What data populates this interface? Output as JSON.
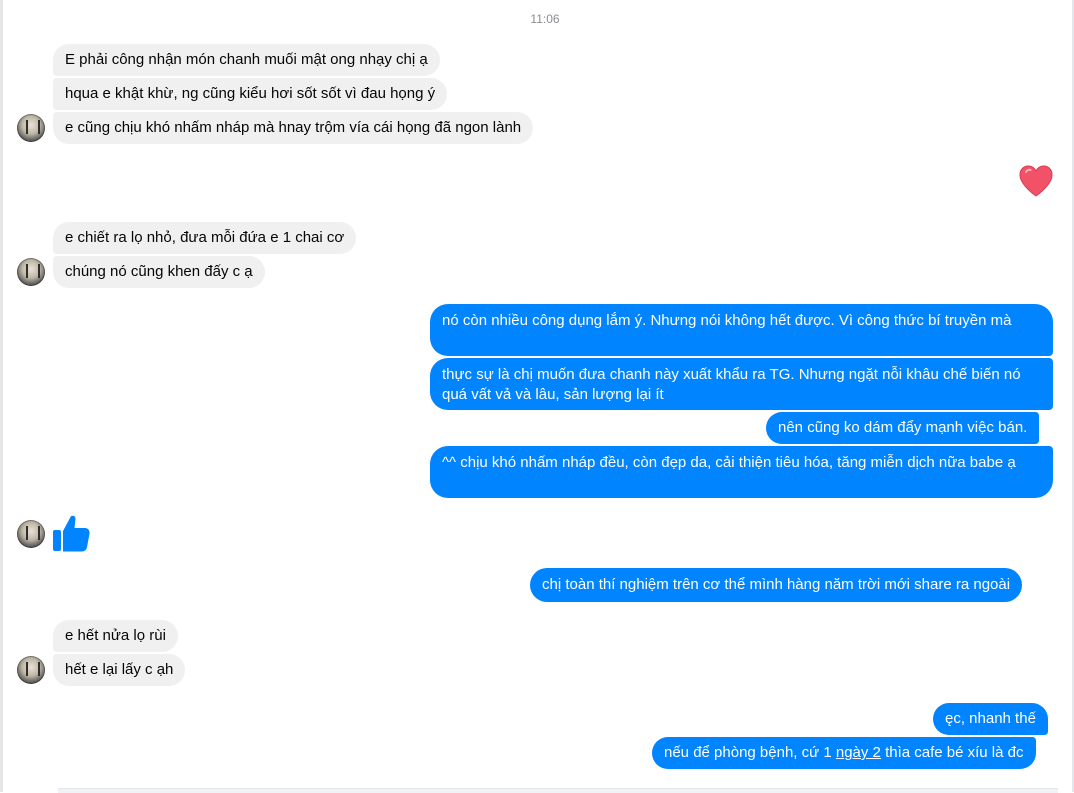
{
  "conversation": {
    "timestamp": "11:06",
    "group1": [
      "E phải công nhận món chanh muối mật ong nhạy chị ạ",
      "hqua e khật khừ, ng cũng kiểu hơi sốt sốt vì đau họng ý",
      "e cũng chịu khó nhấm nháp mà hnay trộm vía cái họng đã ngon lành"
    ],
    "group2": [
      "e chiết ra lọ nhỏ, đưa mỗi đứa e 1 chai cơ",
      "chúng nó cũng khen đấy c ạ"
    ],
    "outgoing1": [
      "nó còn nhiều công dụng lắm ý. Nhưng nói không hết được. Vì công thức bí truyền mà",
      "thực sự là chị muốn đưa chanh này xuất khẩu ra TG. Nhưng ngặt nỗi khâu chế biến nó quá vất vả và lâu, sản lượng lại ít",
      "nên cũng ko dám đẩy mạnh việc bán.",
      "^^ chịu khó nhấm nháp đều, còn đẹp da, cải thiện tiêu hóa, tăng miễn dịch nữa babe ạ"
    ],
    "outgoing2": "chị toàn thí nghiệm trên cơ thể mình hàng năm trời mới share ra ngoài",
    "group3": [
      "e hết nửa lọ rùi",
      "hết e lại lấy c ạh"
    ],
    "outgoing3a": "ęc, nhanh thế",
    "outgoing3b": {
      "before": "nếu để phòng bệnh, cứ 1 ",
      "underlined": "ngày 2",
      "after": " thìa cafe bé xíu là đc"
    }
  },
  "colors": {
    "outgoing_bubble": "#0084ff",
    "incoming_bubble": "#f0f0f0",
    "heart": "#f25268",
    "like": "#0084ff"
  },
  "icons": {
    "heart_reaction": "heart-icon",
    "like": "thumbs-up-icon"
  }
}
